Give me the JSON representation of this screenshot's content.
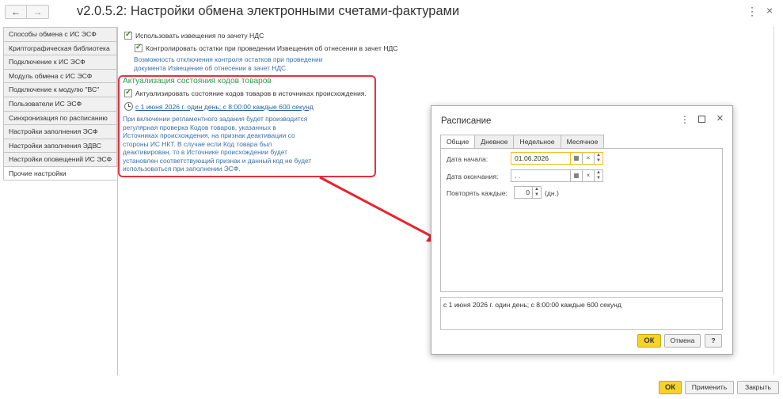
{
  "window": {
    "title": "v2.0.5.2: Настройки обмена электронными счетами-фактурами",
    "back_icon": "←",
    "forward_icon": "→",
    "menu_icon": "⋮",
    "close_icon": "×"
  },
  "sidebar": {
    "items": [
      {
        "label": "Способы обмена с ИС ЭСФ"
      },
      {
        "label": "Криптографическая библиотека"
      },
      {
        "label": "Подключение к ИС ЭСФ"
      },
      {
        "label": "Модуль обмена с ИС ЭСФ"
      },
      {
        "label": "Подключение к модулю \"ВС\""
      },
      {
        "label": "Пользователи ИС ЭСФ"
      },
      {
        "label": "Синхронизация по расписанию"
      },
      {
        "label": "Настройки заполнения ЭСФ"
      },
      {
        "label": "Настройки заполнения ЭДВС"
      },
      {
        "label": "Настройки оповещений ИС ЭСФ"
      },
      {
        "label": "Прочие настройки"
      }
    ]
  },
  "main": {
    "use_vat_notices": "Использовать извещения по зачету НДС",
    "control_balances": "Контролировать остатки при проведении Извещения об отнесении в зачет НДС",
    "control_hint_1": "Возможность отключения контроля остатков при проведении",
    "control_hint_2": "документа Извещение об отнесении в зачет НДС",
    "group_title": "Актуализация состояния кодов товаров",
    "actualize_label": "Актуализировать состояние кодов товаров в источниках происхождения.",
    "schedule_link": "с 1 июня 2026 г. один день; с 8:00:00 каждые 600 секунд",
    "hint_lines": [
      "При включении регламентного задания будет производится",
      "регулярная проверка Кодов товаров, указанных в",
      "Источниках происхождения, на признак деактивации со",
      "стороны ИС НКТ. В случае если Код товара был",
      "деактивирован, то в Источнике происхождении будет",
      "установлен соответствующий признак и данный код не будет",
      "использоваться при заполнении ЭСФ."
    ]
  },
  "dialog": {
    "title": "Расписание",
    "tabs": [
      {
        "label": "Общие"
      },
      {
        "label": "Дневное"
      },
      {
        "label": "Недельное"
      },
      {
        "label": "Месячное"
      }
    ],
    "start_label": "Дата начала:",
    "start_value": "01.06.2026",
    "end_label": "Дата окончания:",
    "end_value": " .  .",
    "repeat_label": "Повторять каждые:",
    "repeat_value": "0",
    "repeat_unit": "(дн.)",
    "summary": "с 1 июня 2026 г. один день; с 8:00:00 каждые 600 секунд",
    "ok_label": "ОК",
    "cancel_label": "Отмена",
    "help_label": "?"
  },
  "footer": {
    "ok_label": "ОК",
    "apply_label": "Применить",
    "close_label": "Закрыть"
  },
  "colors": {
    "accent_ok": "#f5d32a",
    "highlight": "#e53040",
    "group_title": "#2e9a4e",
    "hint": "#3d6fa8"
  }
}
